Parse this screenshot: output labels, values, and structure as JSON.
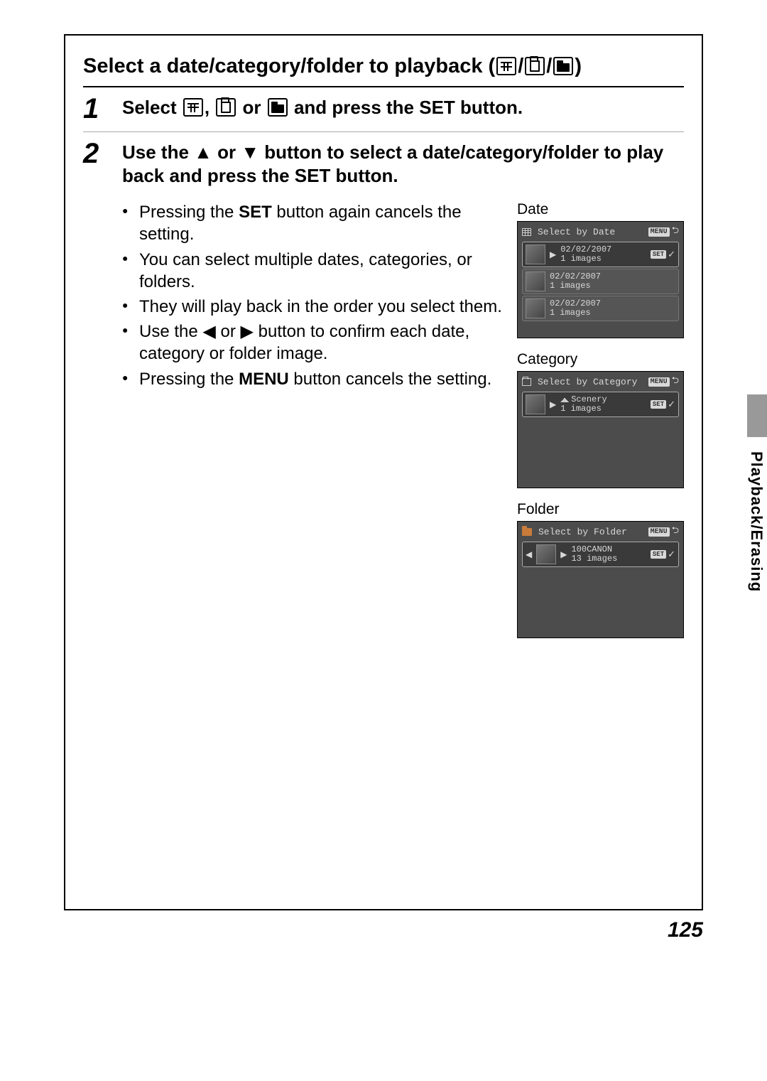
{
  "section_tab": "Playback/Erasing",
  "page_number": "125",
  "title_pre": "Select a date/category/folder to playback (",
  "title_post": ")",
  "steps": {
    "s1": {
      "num": "1",
      "head_pre": "Select ",
      "head_mid1": ", ",
      "head_mid2": " or ",
      "head_post": " and press the SET button."
    },
    "s2": {
      "num": "2",
      "head": "Use the ▲ or ▼ button to select a date/category/folder to play back and press the SET button.",
      "bullets": [
        {
          "pre": "Pressing the ",
          "bold": "SET",
          "post": " button again cancels the setting."
        },
        {
          "pre": "You can select multiple dates, categories, or folders.",
          "bold": "",
          "post": ""
        },
        {
          "pre": "They will play back in the order you select them.",
          "bold": "",
          "post": ""
        },
        {
          "pre": "Use the ◀ or ▶ button to confirm each date, category or folder image.",
          "bold": "",
          "post": ""
        },
        {
          "pre": "Pressing the ",
          "bold": "MENU",
          "post": " button cancels the setting."
        }
      ]
    }
  },
  "screens": {
    "date": {
      "label": "Date",
      "title": "Select by Date",
      "menu": "MENU",
      "set": "SET",
      "rows": [
        {
          "line1": "02/02/2007",
          "line2": "1 images",
          "selected": true
        },
        {
          "line1": "02/02/2007",
          "line2": "1 images",
          "selected": false
        },
        {
          "line1": "02/02/2007",
          "line2": "1 images",
          "selected": false
        }
      ]
    },
    "category": {
      "label": "Category",
      "title": "Select by Category",
      "menu": "MENU",
      "set": "SET",
      "rows": [
        {
          "line1": "Scenery",
          "line2": "1 images",
          "selected": true
        }
      ]
    },
    "folder": {
      "label": "Folder",
      "title": "Select by Folder",
      "menu": "MENU",
      "set": "SET",
      "rows": [
        {
          "line1": "100CANON",
          "line2": "13 images",
          "selected": true
        }
      ]
    }
  }
}
